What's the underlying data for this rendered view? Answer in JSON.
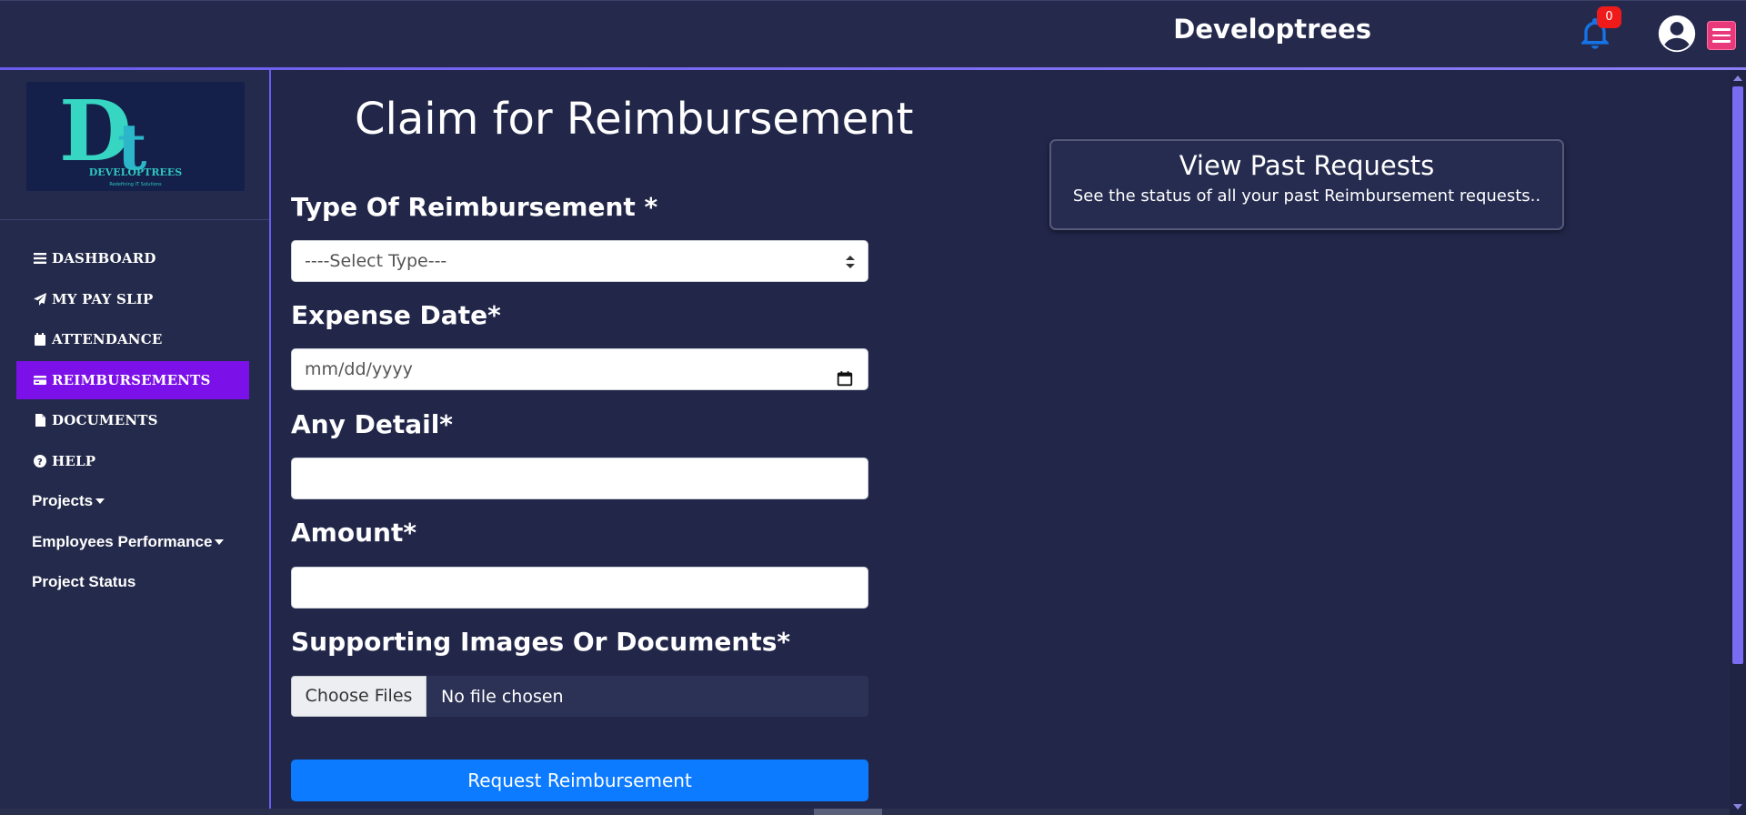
{
  "header": {
    "brand": "Developtrees",
    "notification_count": "0"
  },
  "sidebar": {
    "logo_text": "DEVELOPTREES",
    "logo_tagline": "Redefining IT Solutions",
    "items": [
      {
        "label": "DASHBOARD",
        "icon": "bars-icon"
      },
      {
        "label": "MY PAY SLIP",
        "icon": "paper-plane-icon"
      },
      {
        "label": "ATTENDANCE",
        "icon": "calendar-icon"
      },
      {
        "label": "REIMBURSEMENTS",
        "icon": "credit-card-icon",
        "active": true
      },
      {
        "label": "DOCUMENTS",
        "icon": "file-icon"
      },
      {
        "label": "HELP",
        "icon": "question-circle-icon"
      },
      {
        "label": "Projects",
        "dropdown": true
      },
      {
        "label": "Employees Performance",
        "dropdown": true
      },
      {
        "label": "Project Status"
      }
    ]
  },
  "main": {
    "title": "Claim for Reimbursement",
    "form": {
      "type_label": "Type Of Reimbursement *",
      "type_selected": "----Select Type---",
      "date_label": "Expense Date*",
      "date_placeholder": "mm/dd/yyyy",
      "detail_label": "Any Detail*",
      "detail_value": "",
      "amount_label": "Amount*",
      "amount_value": "",
      "files_label": "Supporting Images Or Documents*",
      "files_button": "Choose Files",
      "files_status": "No file chosen",
      "submit_label": "Request Reimbursement"
    },
    "past_requests": {
      "title": "View Past Requests",
      "description": "See the status of all your past Reimbursement requests.."
    }
  },
  "colors": {
    "background": "#22274a",
    "active_nav": "#7b10e8",
    "primary_button": "#0c7bff",
    "accent": "#6b5cf0",
    "bell": "#1473e6",
    "badge": "#ef1b1b",
    "menu_toggle": "#e83a7a",
    "logo_teal": "#2ec4c0"
  }
}
